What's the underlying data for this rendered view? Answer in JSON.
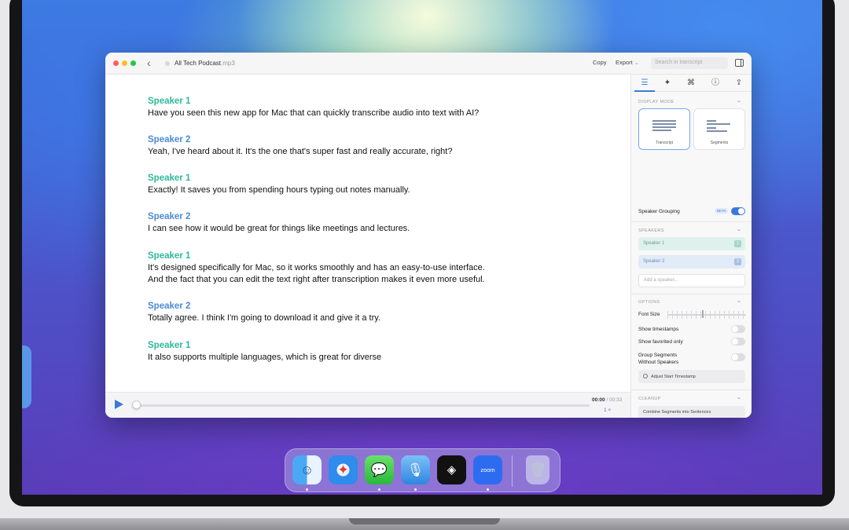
{
  "window": {
    "file_name": "All Tech Podcast",
    "file_ext": ".mp3",
    "copy_label": "Copy",
    "export_label": "Export",
    "search_placeholder": "Search in transcript"
  },
  "transcript": [
    {
      "speaker": "Speaker 1",
      "lines": [
        "Have you seen this new app for Mac that can quickly transcribe audio into text with AI?"
      ]
    },
    {
      "speaker": "Speaker 2",
      "lines": [
        "Yeah, I've heard about it. It's the one that's super fast and really accurate, right?"
      ]
    },
    {
      "speaker": "Speaker 1",
      "lines": [
        "Exactly! It saves you from spending hours typing out notes manually."
      ]
    },
    {
      "speaker": "Speaker 2",
      "lines": [
        "I can see how it would be great for things like meetings and lectures."
      ]
    },
    {
      "speaker": "Speaker 1",
      "lines": [
        "It's designed specifically for Mac, so it works smoothly and has an easy-to-use interface.",
        "And the fact that you can edit the text right after transcription makes it even more useful."
      ]
    },
    {
      "speaker": "Speaker 2",
      "lines": [
        "Totally agree. I think I'm going to download it and give it a try."
      ]
    },
    {
      "speaker": "Speaker 1",
      "lines": [
        "It also supports multiple languages, which is great for diverse"
      ]
    }
  ],
  "player": {
    "current_time": "00:00",
    "total_time": "/ 00:33",
    "speed": "1 ×",
    "progress": 0
  },
  "sidebar": {
    "display_mode_title": "DISPLAY MODE",
    "mode_transcript": "Transcript",
    "mode_segments": "Segments",
    "speaker_grouping": "Speaker Grouping",
    "beta": "BETA",
    "speaker_grouping_on": true,
    "speakers_title": "SPEAKERS",
    "speakers": [
      {
        "name": "Speaker 1",
        "badge": "1"
      },
      {
        "name": "Speaker 2",
        "badge": "2"
      }
    ],
    "add_speaker_placeholder": "Add a speaker...",
    "options_title": "OPTIONS",
    "font_size": "Font Size",
    "show_timestamps": "Show timestamps",
    "show_favorited": "Show favorited only",
    "group_segments_1": "Group Segments",
    "group_segments_2": "Without Speakers",
    "adjust_timestamp": "Adjust Start Timestamp",
    "cleanup_title": "CLEANUP",
    "combine_segments": "Combine Segments into Sentences"
  },
  "colors": {
    "speaker_1": "#2eb89a",
    "speaker_2": "#4a8ad6",
    "accent": "#3b7bd8"
  },
  "dock": [
    "Finder",
    "Safari",
    "Messages",
    "Voice App",
    "Capacities",
    "Zoom",
    "Trash"
  ],
  "dock_zoom_label": "zoom"
}
